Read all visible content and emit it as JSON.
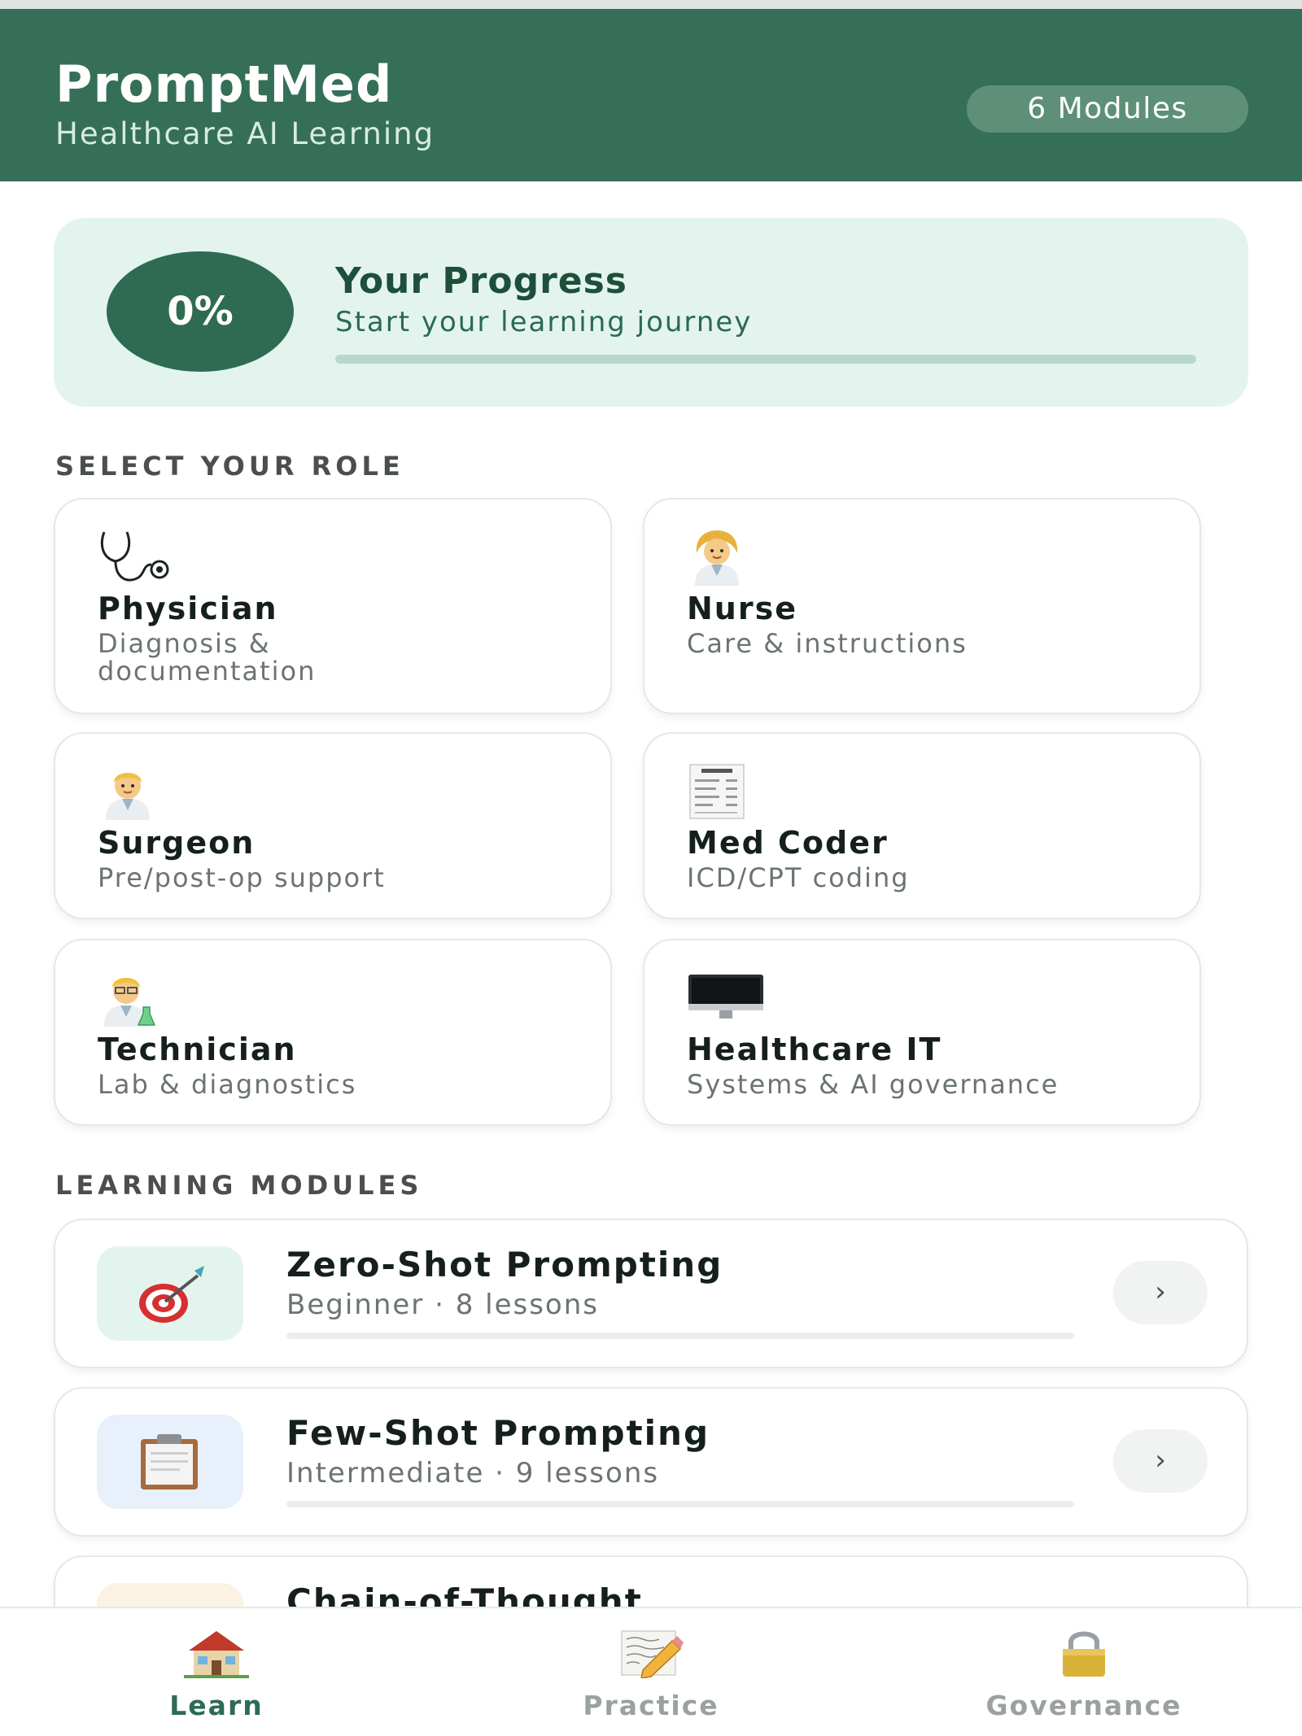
{
  "header": {
    "title": "PromptMed",
    "subtitle": "Healthcare AI Learning",
    "modules_badge": "6 Modules"
  },
  "progress": {
    "percent_label": "0%",
    "percent": 0,
    "title": "Your Progress",
    "subtitle": "Start your learning journey"
  },
  "roles_section": {
    "label": "SELECT YOUR ROLE",
    "roles": [
      {
        "name": "Physician",
        "description": "Diagnosis & documentation",
        "icon": "stethoscope-icon"
      },
      {
        "name": "Nurse",
        "description": "Care & instructions",
        "icon": "nurse-icon"
      },
      {
        "name": "Surgeon",
        "description": "Pre/post-op support",
        "icon": "surgeon-icon"
      },
      {
        "name": "Med Coder",
        "description": "ICD/CPT coding",
        "icon": "receipt-icon"
      },
      {
        "name": "Technician",
        "description": "Lab & diagnostics",
        "icon": "scientist-icon"
      },
      {
        "name": "Healthcare IT",
        "description": "Systems & AI governance",
        "icon": "computer-monitor-icon"
      }
    ]
  },
  "modules_section": {
    "label": "LEARNING MODULES",
    "modules": [
      {
        "title": "Zero-Shot Prompting",
        "meta": "Beginner · 8 lessons",
        "progress": 0,
        "icon": "target-icon",
        "thumb_color": "#e3f4ee"
      },
      {
        "title": "Few-Shot Prompting",
        "meta": "Intermediate · 9 lessons",
        "progress": 0,
        "icon": "clipboard-icon",
        "thumb_color": "#e7f0fb"
      },
      {
        "title": "Chain-of-Thought",
        "meta": "",
        "progress": 0,
        "icon": "",
        "thumb_color": "#fbf2e3"
      }
    ]
  },
  "tabs": [
    {
      "label": "Learn",
      "icon": "house-icon",
      "active": true
    },
    {
      "label": "Practice",
      "icon": "memo-icon",
      "active": false
    },
    {
      "label": "Governance",
      "icon": "lock-icon",
      "active": false
    }
  ],
  "colors": {
    "brand": "#356f57",
    "accent": "#2f6b53",
    "active_tab": "#2f6b53",
    "inactive_tab": "#9aa19e"
  }
}
